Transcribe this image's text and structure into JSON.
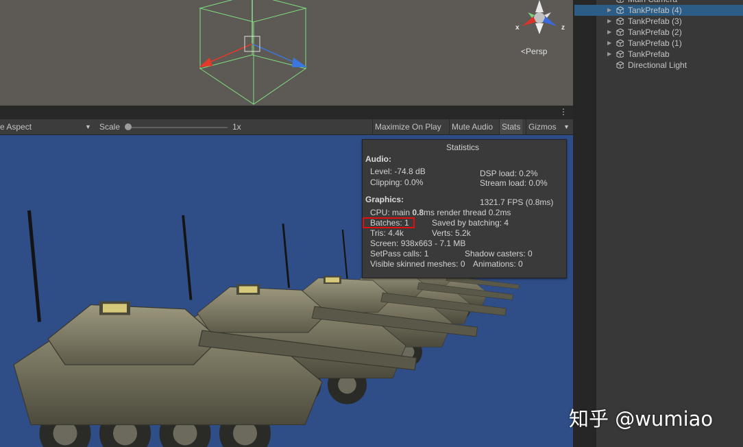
{
  "scene_view": {
    "persp_label": "Persp",
    "gizmo_x": "x",
    "gizmo_z": "z"
  },
  "game_toolbar": {
    "aspect_label": "e Aspect",
    "scale_label": "Scale",
    "scale_value": "1x",
    "maximize_on_play": "Maximize On Play",
    "mute_audio": "Mute Audio",
    "stats": "Stats",
    "gizmos": "Gizmos"
  },
  "statistics": {
    "title": "Statistics",
    "audio_header": "Audio:",
    "level": "Level: -74.8 dB",
    "clipping": "Clipping: 0.0%",
    "dsp_load": "DSP load: 0.2%",
    "stream_load": "Stream load: 0.0%",
    "graphics_header": "Graphics:",
    "fps": "1321.7 FPS (0.8ms)",
    "cpu_prefix": "CPU: main ",
    "cpu_main": "0.8",
    "cpu_suffix": "ms  render thread 0.2ms",
    "batches": "Batches: 1",
    "saved_by_batching": "Saved by batching: 4",
    "tris": "Tris: 4.4k",
    "verts": "Verts: 5.2k",
    "screen": "Screen: 938x663 - 7.1 MB",
    "setpass": "SetPass calls: 1",
    "shadow_casters": "Shadow casters: 0",
    "visible_skinned": "Visible skinned meshes: 0",
    "animations": "Animations: 0"
  },
  "hierarchy": {
    "items": [
      {
        "label": "Main Camera",
        "expandable": false,
        "selected": false
      },
      {
        "label": "TankPrefab (4)",
        "expandable": true,
        "selected": true
      },
      {
        "label": "TankPrefab (3)",
        "expandable": true,
        "selected": false
      },
      {
        "label": "TankPrefab (2)",
        "expandable": true,
        "selected": false
      },
      {
        "label": "TankPrefab (1)",
        "expandable": true,
        "selected": false
      },
      {
        "label": "TankPrefab",
        "expandable": true,
        "selected": false
      },
      {
        "label": "Directional Light",
        "expandable": false,
        "selected": false
      }
    ]
  },
  "watermark": "知乎 @wumiao",
  "colors": {
    "game_background": "#2f4d87",
    "scene_background": "#5d5955",
    "selection": "#2c5d87",
    "highlight_box": "#e01010"
  }
}
